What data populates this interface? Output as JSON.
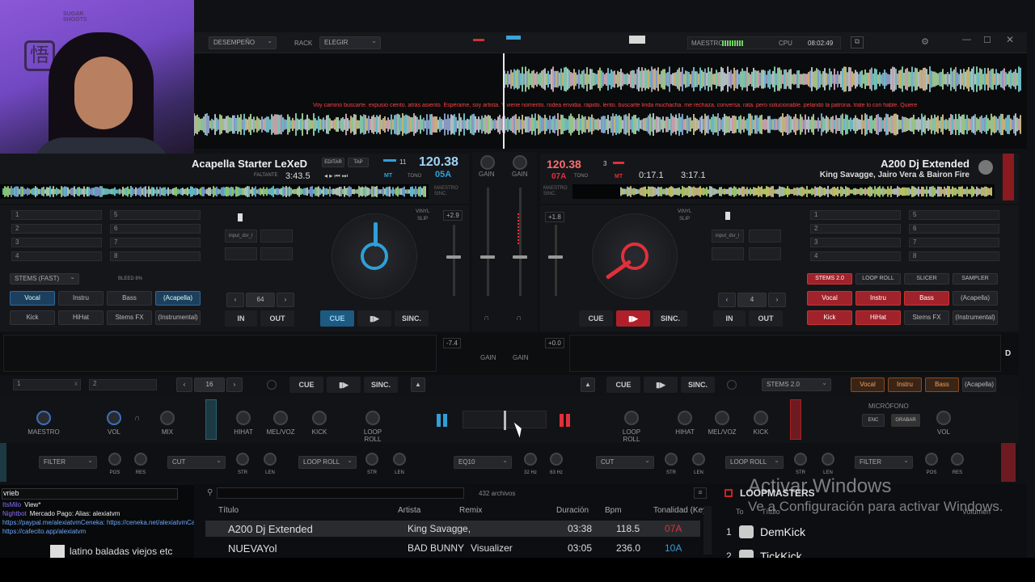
{
  "topbar": {
    "layout_select": "DESEMPEÑO",
    "rack_label": "RACK",
    "rack_select": "ELEGIR",
    "master_label": "MAESTRO",
    "cpu_label": "CPU",
    "clock": "08:02:49"
  },
  "lyrics": "Voy camino buscarte. expusio ciento. atrás asiento. Espérame, soy artista. Y viene nomento. rodea envidia. rápido. lento. buscarte linda muchacha. me rechaza. conversa. rata. pero solucionable. pelando la patrona. trate lo con hable. Quiere",
  "deck_left": {
    "title": "Acapella Starter LeXeD",
    "remaining_label": "FALTANTE",
    "time": "3:43.5",
    "edit_label": "EDITAR",
    "tap_label": "TAP",
    "beat_count": "11",
    "bpm": "120.38",
    "key": "05A",
    "mt": "MT",
    "tono": "TONO",
    "master_label": "MAESTRO",
    "sync_small": "SINC.",
    "vinyl": "VINYL",
    "slip": "SLIP",
    "pitch": "+2.9",
    "hotcues_left": [
      "1",
      "2",
      "3",
      "4"
    ],
    "hotcues_right": [
      "5",
      "6",
      "7",
      "8"
    ],
    "stems_select": "STEMS (FAST)",
    "bleed": "BLEED 8%",
    "stems_row1": [
      "Vocal",
      "Instru",
      "Bass",
      "(Acapella)"
    ],
    "stems_row2": [
      "Kick",
      "HiHat",
      "Stems FX",
      "(Instrumental)"
    ],
    "loop_size": "64",
    "in_label": "IN",
    "out_label": "OUT",
    "cue": "CUE",
    "sync": "SINC.",
    "fx_slot": "input_dsr_l"
  },
  "deck_right": {
    "title": "A200 Dj Extended",
    "artist": "King Savagge, Jairo Vera & Bairon Fire",
    "bpm": "120.38",
    "beat_count": "3",
    "key": "07A",
    "mt": "MT",
    "tono": "TONO",
    "elapsed": "0:17.1",
    "total": "3:17.1",
    "master_label": "MAESTRO",
    "sync_small": "SINC.",
    "vinyl": "VINYL",
    "slip": "SLIP",
    "pitch": "+1.8",
    "hotcues_left": [
      "1",
      "2",
      "3",
      "4"
    ],
    "hotcues_right": [
      "5",
      "6",
      "7",
      "8"
    ],
    "pad_tabs": [
      "STEMS 2.0",
      "LOOP ROLL",
      "SLICER",
      "SAMPLER"
    ],
    "stems_row1": [
      "Vocal",
      "Instru",
      "Bass",
      "(Acapella)"
    ],
    "stems_row2": [
      "Kick",
      "HiHat",
      "Stems FX",
      "(Instrumental)"
    ],
    "loop_size": "4",
    "in_label": "IN",
    "out_label": "OUT",
    "cue": "CUE",
    "sync": "SINC.",
    "fx_slot": "input_dsr_l"
  },
  "mixer": {
    "gain": "GAIN",
    "pitch_left": "-7.4",
    "pitch_right": "+0.0"
  },
  "lower_left": {
    "slots": [
      "1",
      "2"
    ],
    "loop_size": "16",
    "cue": "CUE",
    "sync": "SINC."
  },
  "lower_right": {
    "cue": "CUE",
    "sync": "SINC.",
    "stems_select": "STEMS 2.0",
    "stems": [
      "Vocal",
      "Instru",
      "Bass",
      "(Acapella)"
    ],
    "mic_label": "MICRÓFONO",
    "enc": "ENC",
    "rec": "GRABAR",
    "vol": "VOL",
    "side_letter": "D"
  },
  "knobs": {
    "maestro": "MAESTRO",
    "vol": "VOL",
    "mix": "MIX",
    "left": [
      "HIHAT",
      "MEL/VOZ",
      "KICK",
      "LOOP ROLL"
    ],
    "right": [
      "LOOP ROLL",
      "HIHAT",
      "MEL/VOZ",
      "KICK"
    ]
  },
  "fx_row": {
    "filter_l": "FILTER",
    "cut_l": "CUT",
    "loop_roll_l": "LOOP ROLL",
    "eq": "EQ10",
    "cut_r": "CUT",
    "loop_roll_r": "LOOP ROLL",
    "filter_r": "FILTER",
    "labels": [
      "POS",
      "RES",
      "STR",
      "LEN",
      "STR",
      "LEN",
      "32 Hz",
      "63 Hz",
      "STR",
      "LEN",
      "STR",
      "LEN",
      "POS",
      "RES"
    ]
  },
  "browser": {
    "file_count": "432 archivos",
    "columns": [
      "Título",
      "Artista",
      "Remix",
      "Duración",
      "Bpm",
      "Tonalidad (Key)"
    ],
    "rows": [
      {
        "title": "A200 Dj Extended",
        "artist": "King Savagge,",
        "remix": "",
        "duration": "03:38",
        "bpm": "118.5",
        "key": "07A"
      },
      {
        "title": "NUEVAYol",
        "artist": "BAD BUNNY",
        "remix": "Visualizer",
        "duration": "03:05",
        "bpm": "236.0",
        "key": "10A"
      }
    ],
    "sampler_title": "LOOPMASTERS",
    "sampler_cols": [
      "To",
      "Título",
      "Volumen"
    ],
    "sampler_rows": [
      {
        "num": "1",
        "name": "DemKick"
      },
      {
        "num": "2",
        "name": "TickKick"
      }
    ]
  },
  "chat": {
    "input": "vrieb",
    "lines": [
      {
        "user": "ItsMilo",
        "text": "View*"
      },
      {
        "user": "Nightbot",
        "text": "Mercado Pago: Alias: alexiatvm"
      },
      {
        "user": "",
        "text": "https://paypal.me/alexiatvmCeneka: https://ceneka.net/alexiatvmCafecito:"
      },
      {
        "user": "",
        "text": "https://cafecito.app/alexiatvm"
      }
    ],
    "playlist": "latino baladas viejos etc",
    "cam_text": "SUGAR SHOOTS"
  },
  "watermark": {
    "title": "Activar Windows",
    "subtitle": "Ve a Configuración para activar Windows."
  },
  "colors": {
    "deck_left_accent": "#2f9fd8",
    "deck_right_accent": "#e0303a",
    "bpm_left": "#9fd4f5",
    "bpm_right": "#ff6b6b"
  }
}
